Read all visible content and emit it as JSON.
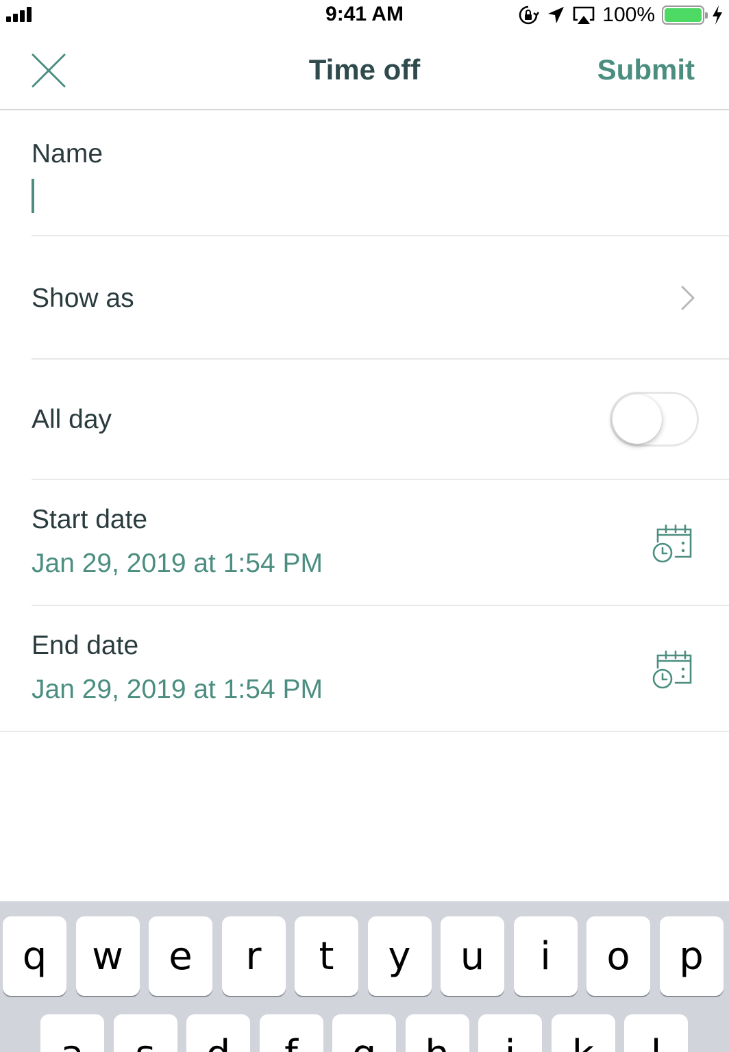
{
  "status_bar": {
    "time": "9:41 AM",
    "battery_percent": "100%",
    "battery_level": 1.0,
    "icons": [
      "signal-bars-icon",
      "orientation-lock-icon",
      "location-arrow-icon",
      "airplay-icon",
      "battery-icon",
      "charging-bolt-icon"
    ]
  },
  "nav": {
    "title": "Time off",
    "submit_label": "Submit",
    "close_icon": "close-icon"
  },
  "form": {
    "name": {
      "label": "Name",
      "value": ""
    },
    "show_as": {
      "label": "Show as"
    },
    "all_day": {
      "label": "All day",
      "on": false
    },
    "start_date": {
      "label": "Start date",
      "value": "Jan 29, 2019 at 1:54 PM"
    },
    "end_date": {
      "label": "End date",
      "value": "Jan 29, 2019 at 1:54 PM"
    }
  },
  "colors": {
    "accent": "#4b8e80",
    "title": "#2f4a4d",
    "keyboard_bg": "#d2d4dc"
  },
  "keyboard": {
    "row1": [
      "q",
      "w",
      "e",
      "r",
      "t",
      "y",
      "u",
      "i",
      "o",
      "p"
    ],
    "row2": [
      "a",
      "s",
      "d",
      "f",
      "g",
      "h",
      "j",
      "k",
      "l"
    ]
  }
}
